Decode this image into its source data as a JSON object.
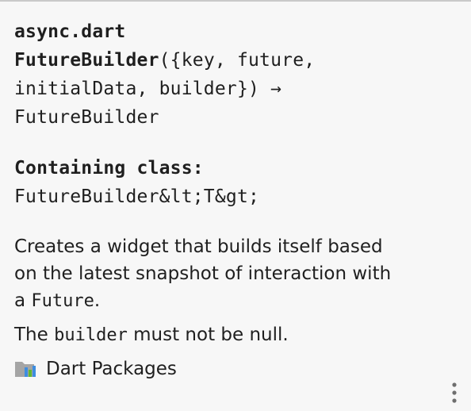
{
  "doc": {
    "file": "async.dart",
    "signature": {
      "name": "FutureBuilder",
      "params_line1": "({key, future,",
      "params_line2": "initialData, builder}) →",
      "return_type": "FutureBuilder"
    },
    "containing_label": "Containing class:",
    "containing_value": "FutureBuilder&lt;T&gt;",
    "description": {
      "line1": "Creates a widget that builds itself based",
      "line2": "on the latest snapshot of interaction with",
      "line3_prefix": "a ",
      "line3_code": "Future",
      "line3_suffix": ".",
      "para2_prefix": "The ",
      "para2_code": "builder",
      "para2_suffix": " must not be null."
    },
    "footer": {
      "library_label": "Dart Packages",
      "library_icon": "library-folder-icon",
      "more_icon": "more-vertical-icon"
    }
  },
  "colors": {
    "background": "#f7f7f7",
    "text": "#1f1f1f",
    "icon_gray": "#8c8c8c",
    "icon_blue": "#3d8de0",
    "icon_green": "#5fb832"
  }
}
